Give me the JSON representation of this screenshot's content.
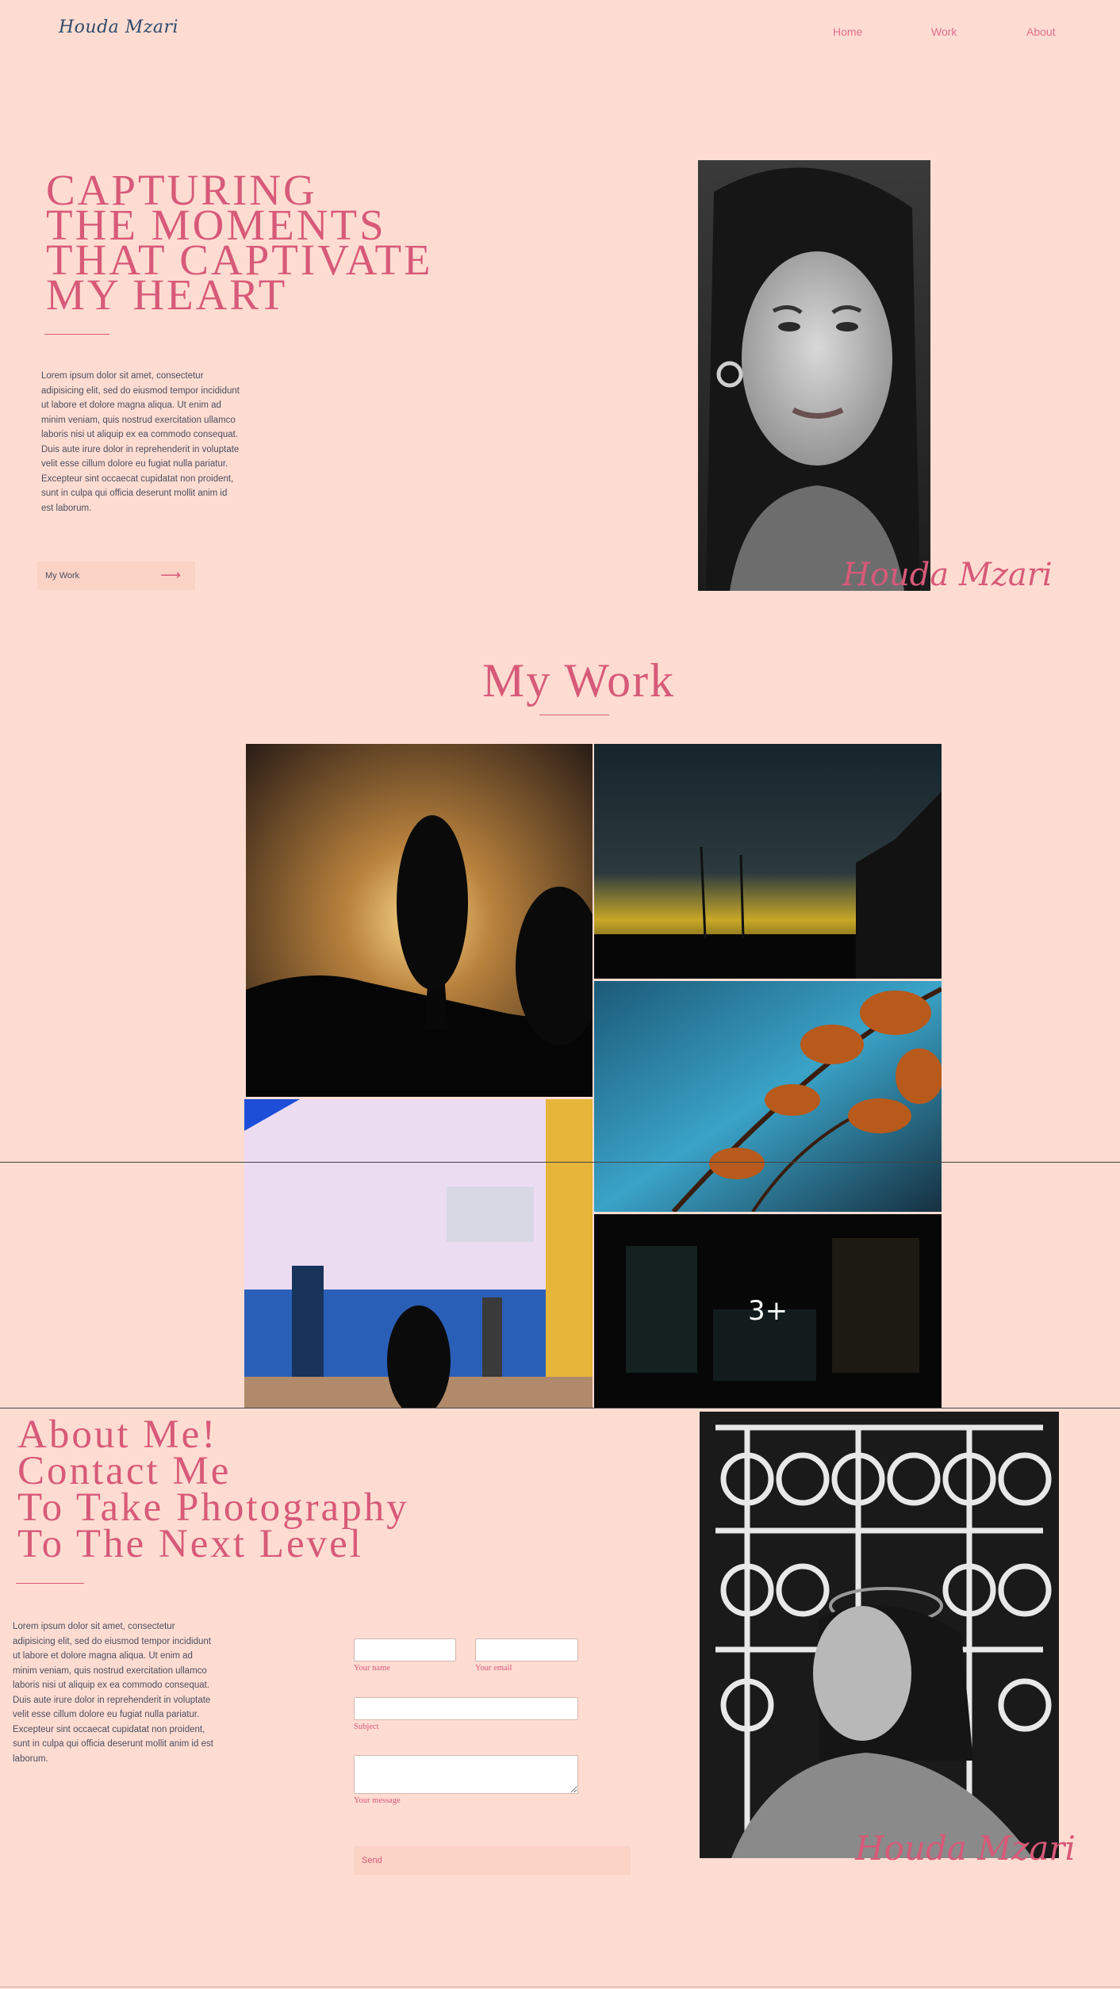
{
  "header": {
    "logo": "Houda Mzari",
    "nav": [
      "Home",
      "Work",
      "About"
    ]
  },
  "hero": {
    "title_lines": [
      "CAPTURING",
      "THE MOMENTS",
      "THAT CAPTIVATE",
      "MY HEART"
    ],
    "paragraph": "Lorem ipsum dolor sit amet, consectetur adipisicing elit, sed do eiusmod tempor incididunt ut labore et dolore magna aliqua. Ut enim ad minim veniam, quis nostrud exercitation ullamco laboris nisi ut aliquip ex ea commodo consequat. Duis aute irure dolor in reprehenderit in voluptate velit esse cillum dolore eu fugiat nulla pariatur. Excepteur sint occaecat cupidatat non proident, sunt in culpa qui officia deserunt mollit anim id est laborum.",
    "button_label": "My Work",
    "signature": "Houda Mzari"
  },
  "work": {
    "title": "My Work",
    "more_badge": "3+"
  },
  "about": {
    "title_lines": [
      "About Me!",
      "Contact Me",
      "To Take Photography",
      "To The Next Level"
    ],
    "paragraph": "Lorem ipsum dolor sit amet, consectetur adipisicing elit, sed do eiusmod tempor incididunt ut labore et dolore magna aliqua. Ut enim ad minim veniam, quis nostrud exercitation ullamco laboris nisi ut aliquip ex ea commodo consequat. Duis aute irure dolor in reprehenderit in voluptate velit esse cillum dolore eu fugiat nulla pariatur. Excepteur sint occaecat cupidatat non proident, sunt in culpa qui officia deserunt mollit anim id est laborum.",
    "form": {
      "name_label": "Your name",
      "email_label": "Your email",
      "subject_label": "Subject",
      "message_label": "Your message",
      "send_label": "Send"
    },
    "signature": "Houda Mzari"
  },
  "colors": {
    "background": "#ffdcd2",
    "accent": "#d75a78",
    "button": "#fbd2c6",
    "text": "#4a4f60"
  }
}
